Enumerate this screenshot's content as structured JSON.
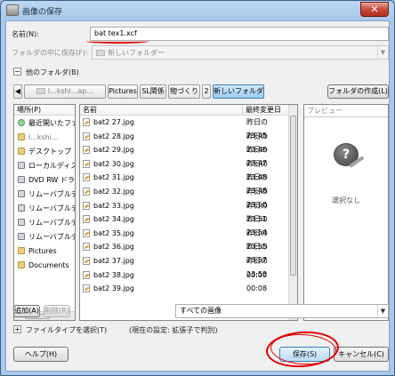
{
  "window": {
    "title": "画像の保存",
    "close_label": "✕"
  },
  "name": {
    "label": "名前(N):",
    "value": "bat tex1.xcf"
  },
  "save_in_folder": {
    "label": "フォルダの中に保存(F):",
    "value": "新しいフォルダー"
  },
  "browse_other": {
    "label": "他のフォルダ(B)",
    "icon": "collapse-icon"
  },
  "path_bar": {
    "crumbs": [
      "Pictures",
      "SL関係",
      "物づくり",
      "2",
      "新しいフォルダー"
    ],
    "hidden_first_crumb": "l...kshi...ap...",
    "create_folder": "フォルダの作成(L)"
  },
  "places": {
    "header": "場所(P)",
    "items": [
      {
        "label": "最近開いたファイル",
        "icon": "recent-icon"
      },
      {
        "label": "l...kshi...",
        "icon": "user-folder-icon"
      },
      {
        "label": "デスクトップ",
        "icon": "desktop-icon"
      },
      {
        "label": "ローカルディスク",
        "icon": "drive-icon"
      },
      {
        "label": "DVD RW ドライブ",
        "icon": "dvd-icon"
      },
      {
        "label": "リムーバブルディスク",
        "icon": "removable-icon"
      },
      {
        "label": "リムーバブルディスク",
        "icon": "removable-icon"
      },
      {
        "label": "リムーバブルディスク",
        "icon": "removable-icon"
      },
      {
        "label": "リムーバブルディスク",
        "icon": "removable-icon"
      },
      {
        "label": "Pictures",
        "icon": "folder-icon"
      },
      {
        "label": "Documents",
        "icon": "folder-icon"
      }
    ],
    "add_button": "追加(A)",
    "remove_button": "削除(R)"
  },
  "file_list": {
    "col_name": "名前",
    "col_modified": "最終変更日",
    "rows": [
      {
        "name": "bat2 27.jpg",
        "date": "昨日の 23:45"
      },
      {
        "name": "bat2 28.jpg",
        "date": "昨日の 23:46"
      },
      {
        "name": "bat2 29.jpg",
        "date": "昨日の 23:47"
      },
      {
        "name": "bat2 30.jpg",
        "date": "昨日の 23:48"
      },
      {
        "name": "bat2 31.jpg",
        "date": "昨日の 23:48"
      },
      {
        "name": "bat2 32.jpg",
        "date": "昨日の 23:50"
      },
      {
        "name": "bat2 33.jpg",
        "date": "昨日の 23:51"
      },
      {
        "name": "bat2 34.jpg",
        "date": "昨日の 23:54"
      },
      {
        "name": "bat2 35.jpg",
        "date": "昨日の 23:55"
      },
      {
        "name": "bat2 36.jpg",
        "date": "昨日の 23:57"
      },
      {
        "name": "bat2 37.jpg",
        "date": "昨日の 23:58"
      },
      {
        "name": "bat2 38.jpg",
        "date": "00:00"
      },
      {
        "name": "bat2 39.jpg",
        "date": "00:08"
      }
    ]
  },
  "preview": {
    "header": "プレビュー",
    "none_text": "選択なし",
    "icon": "gimp-icon"
  },
  "filter": {
    "value": "すべての画像"
  },
  "file_type": {
    "label": "ファイルタイプを選択(T)",
    "current": "(現在の設定: 拡張子で判別)"
  },
  "buttons": {
    "help": "ヘルプ(H)",
    "save": "保存(S)",
    "cancel": "キャンセル(C)"
  },
  "colors": {
    "annotation_red": "#e10000",
    "selection_blue": "#9ecdf3"
  }
}
